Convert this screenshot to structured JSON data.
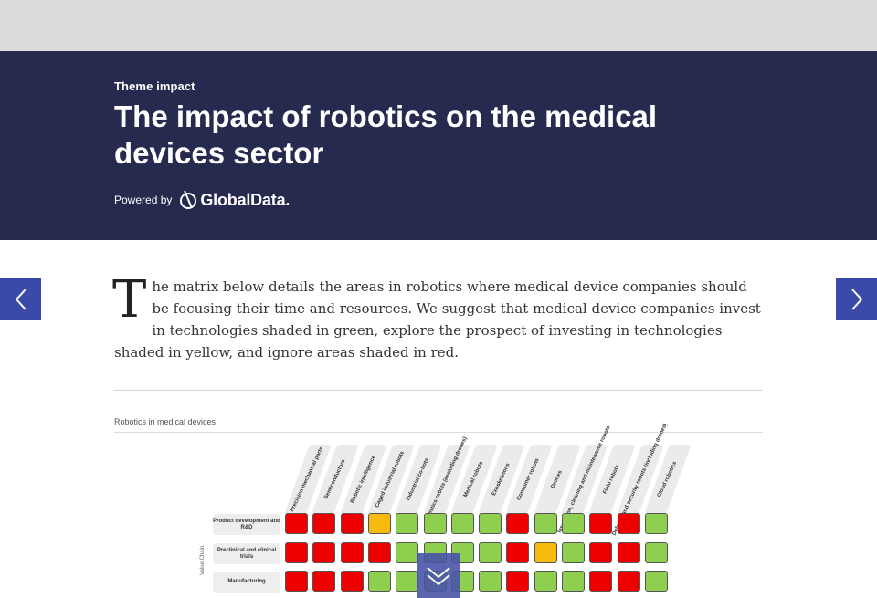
{
  "hero": {
    "eyebrow": "Theme impact",
    "title": "The impact of robotics on the medical devices sector",
    "powered_by": "Powered by",
    "brand": "GlobalData."
  },
  "article": {
    "dropcap": "T",
    "intro": "he matrix below details the areas in robotics where medical device companies should be focusing their time and resources. We suggest that medical device companies invest in technologies shaded in green, explore the prospect of investing in technologies shaded in yellow, and ignore areas shaded in red."
  },
  "figure": {
    "title": "Robotics in medical devices",
    "value_chain_label": "Value Chain",
    "columns": [
      "Precision mechanical parts",
      "Semiconductors",
      "Robotic intelligence",
      "Caged industrial robots",
      "Industrial co-bots",
      "Logistics robots (excluding drones)",
      "Medical robots",
      "Exoskeletons",
      "Consumer robots",
      "Drones",
      "Inspection, cleaning and maintenance robots",
      "Field robots",
      "Defense and security robots (including drones)",
      "Cloud robotics"
    ],
    "rows": [
      {
        "label": "Product development and R&D",
        "cells": [
          "red",
          "red",
          "red",
          "yellow",
          "green",
          "green",
          "green",
          "green",
          "red",
          "green",
          "green",
          "red",
          "red",
          "green"
        ]
      },
      {
        "label": "Preclinical and clinical trials",
        "cells": [
          "red",
          "red",
          "red",
          "red",
          "green",
          "green",
          "green",
          "green",
          "red",
          "yellow",
          "green",
          "red",
          "red",
          "green"
        ]
      },
      {
        "label": "Manufacturing",
        "cells": [
          "red",
          "red",
          "red",
          "green",
          "green",
          "green",
          "green",
          "green",
          "red",
          "green",
          "green",
          "red",
          "red",
          "green"
        ]
      }
    ],
    "colors": {
      "red": "#ee0000",
      "green": "#8fcf50",
      "yellow": "#f7bb10"
    }
  },
  "nav": {
    "prev_icon": "chevron-left-icon",
    "next_icon": "chevron-right-icon",
    "scroll_icon": "double-chevron-down-icon"
  }
}
